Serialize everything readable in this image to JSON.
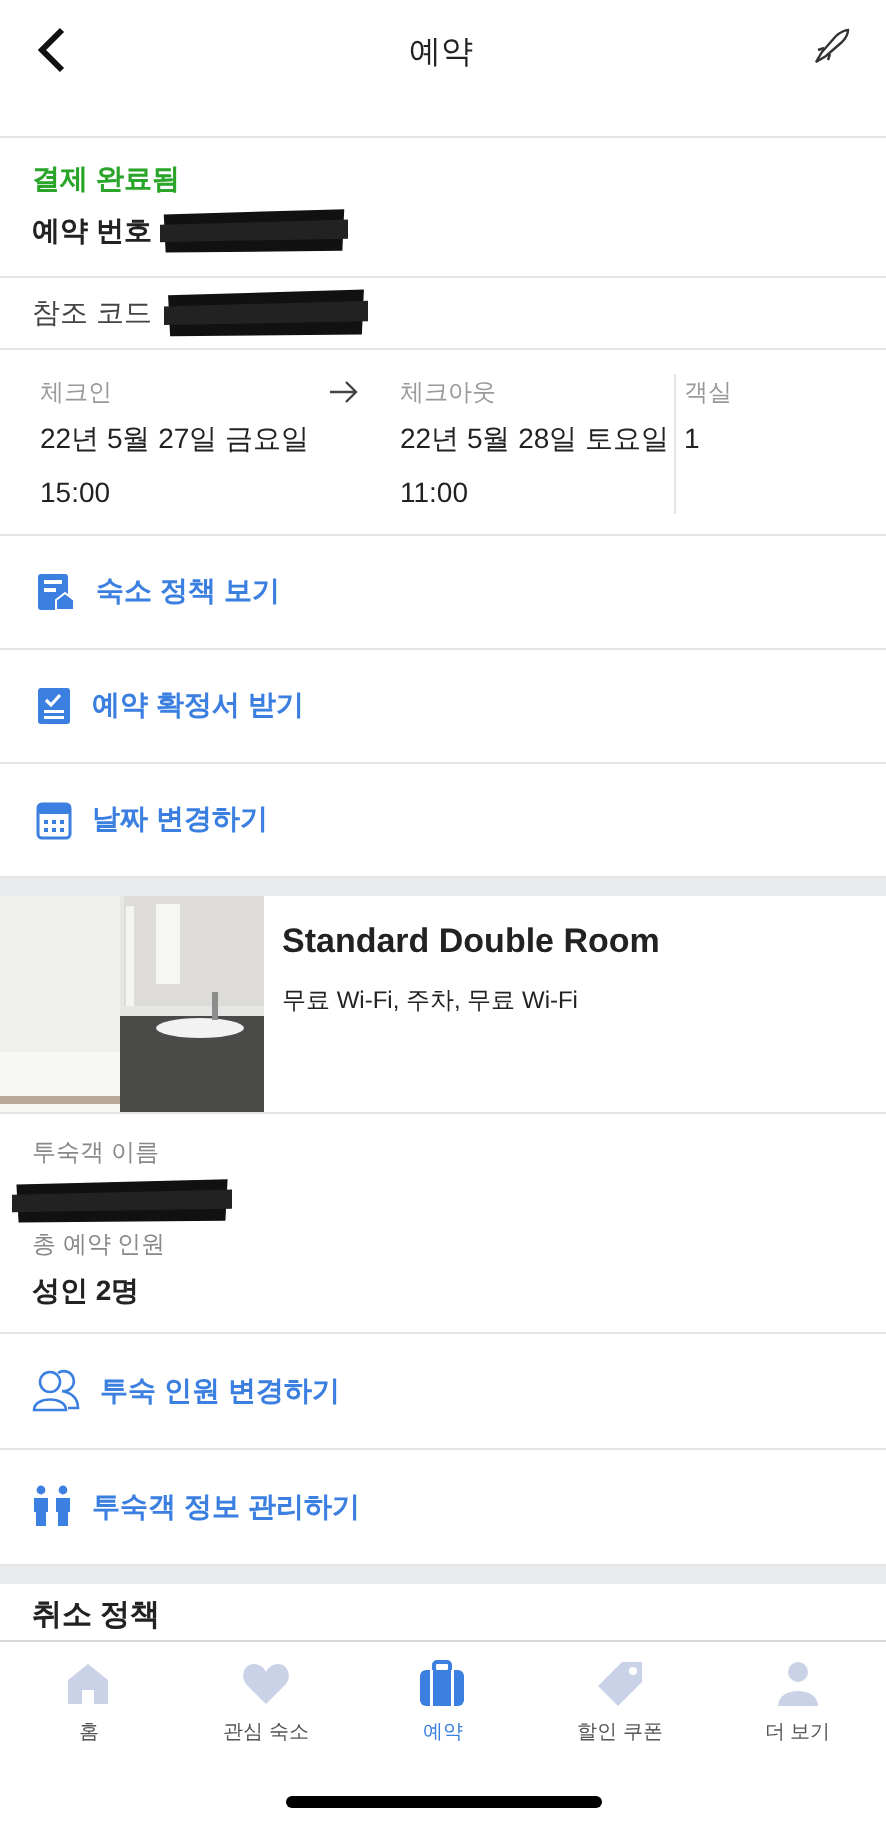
{
  "header": {
    "title": "예약"
  },
  "booking": {
    "status": "결제 완료됨",
    "number_label": "예약 번호",
    "reference_label": "참조 코드"
  },
  "dates": {
    "checkin_label": "체크인",
    "checkin_date": "22년 5월 27일 금요일",
    "checkin_time": "15:00",
    "checkout_label": "체크아웃",
    "checkout_date": "22년 5월 28일 토요일",
    "checkout_time": "11:00",
    "rooms_label": "객실",
    "rooms": "1"
  },
  "actions": [
    "숙소 정책 보기",
    "예약 확정서 받기",
    "날짜 변경하기"
  ],
  "room": {
    "name": "Standard Double Room",
    "amenities": "무료 Wi-Fi, 주차, 무료 Wi-Fi"
  },
  "guest": {
    "name_label": "투숙객 이름",
    "count_label": "총 예약 인원",
    "count": "성인 2명"
  },
  "guest_actions": [
    "투숙 인원 변경하기",
    "투숙객 정보 관리하기"
  ],
  "cancellation": {
    "title": "취소 정책"
  },
  "tabs": [
    {
      "label": "홈",
      "selected": false
    },
    {
      "label": "관심 숙소",
      "selected": false
    },
    {
      "label": "예약",
      "selected": true
    },
    {
      "label": "할인 쿠폰",
      "selected": false
    },
    {
      "label": "더 보기",
      "selected": false
    }
  ]
}
